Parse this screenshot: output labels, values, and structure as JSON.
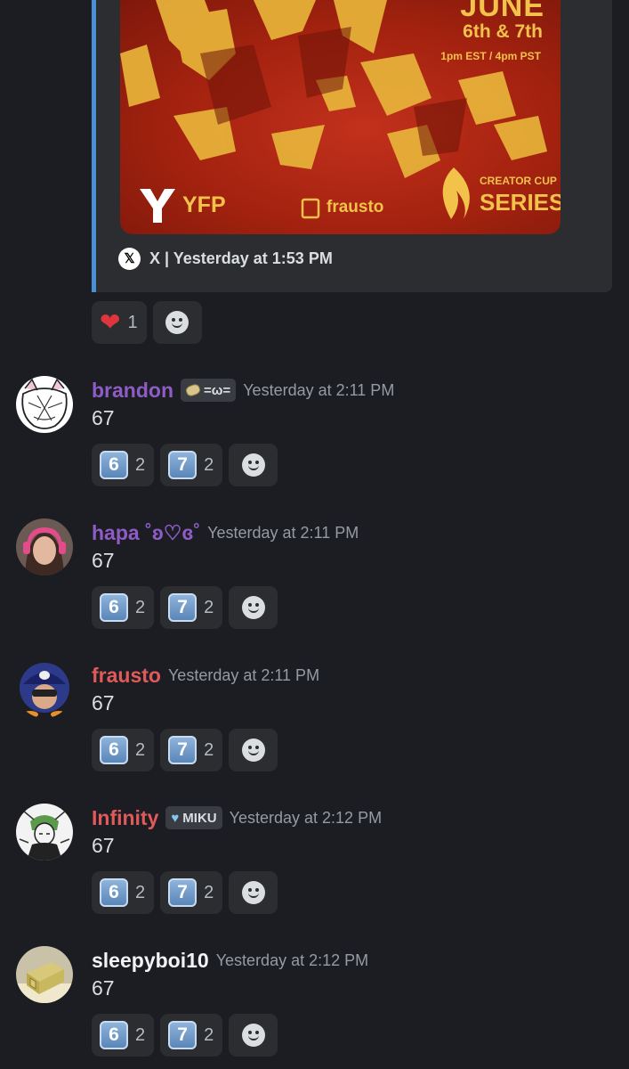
{
  "embed": {
    "poster": {
      "month": "JUNE",
      "dates": "6th & 7th",
      "time": "1pm EST / 4pm PST",
      "brand_left": "YFP",
      "brand_middle": "frausto",
      "brand_right_top": "CREATOR CUP",
      "brand_right_bottom": "SERIES"
    },
    "footer": {
      "source_icon": "x-logo-icon",
      "text": "X | Yesterday at 1:53 PM"
    }
  },
  "embed_reactions": [
    {
      "emoji": "❤️",
      "count": "1"
    }
  ],
  "messages": [
    {
      "username": "brandon",
      "color": "#8e5cc4",
      "tag": {
        "icon": "potato-icon",
        "text": "=ω="
      },
      "timestamp": "Yesterday at 2:11 PM",
      "content": "67",
      "reactions": [
        {
          "emoji": "6",
          "count": "2"
        },
        {
          "emoji": "7",
          "count": "2"
        }
      ]
    },
    {
      "username": "hapa ˚ʚ♡ɞ˚",
      "color": "#8e5cc4",
      "timestamp": "Yesterday at 2:11 PM",
      "content": "67",
      "reactions": [
        {
          "emoji": "6",
          "count": "2"
        },
        {
          "emoji": "7",
          "count": "2"
        }
      ]
    },
    {
      "username": "frausto",
      "color": "#e05a5a",
      "timestamp": "Yesterday at 2:11 PM",
      "content": "67",
      "reactions": [
        {
          "emoji": "6",
          "count": "2"
        },
        {
          "emoji": "7",
          "count": "2"
        }
      ]
    },
    {
      "username": "Infinity",
      "color": "#e05a5a",
      "tag": {
        "icon": "blue-heart-icon",
        "text": "MIKU"
      },
      "timestamp": "Yesterday at 2:12 PM",
      "content": "67",
      "reactions": [
        {
          "emoji": "6",
          "count": "2"
        },
        {
          "emoji": "7",
          "count": "2"
        }
      ]
    },
    {
      "username": "sleepyboi10",
      "color": "#f2f3f5",
      "timestamp": "Yesterday at 2:12 PM",
      "content": "67",
      "reactions": [
        {
          "emoji": "6",
          "count": "2"
        },
        {
          "emoji": "7",
          "count": "2"
        }
      ]
    }
  ]
}
